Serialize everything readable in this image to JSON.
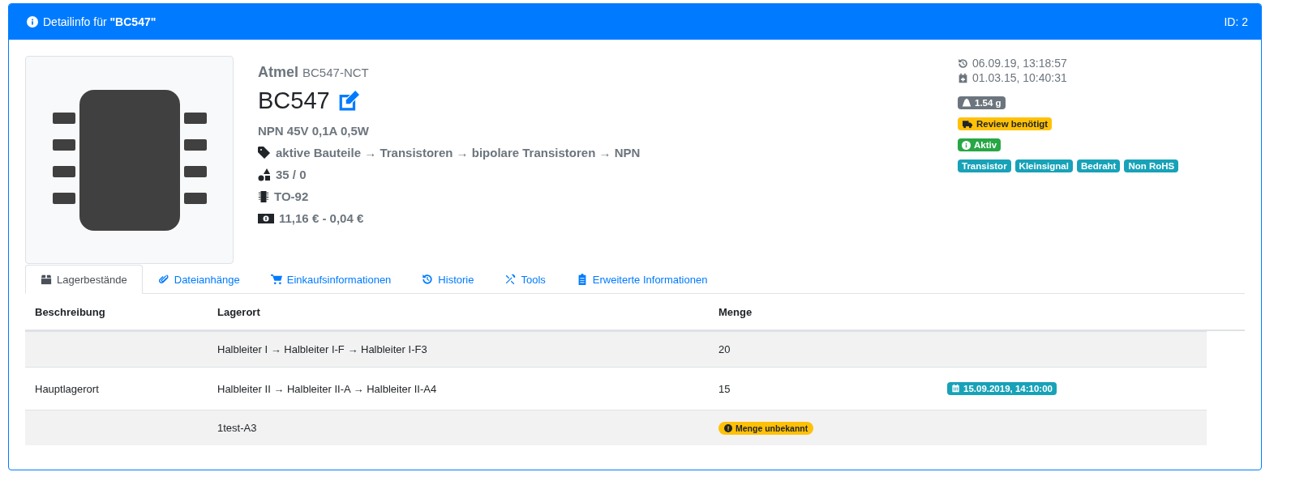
{
  "header": {
    "title": "Detailinfo für **\"BC547\"**",
    "id": "ID: 2"
  },
  "part": {
    "manufacturer": "Atmel",
    "mpn": "BC547-NCT",
    "name": "BC547",
    "description": "NPN 45V 0,1A 0,5W",
    "category": "aktive Bauteile → Transistoren → bipolare Transistoren → NPN",
    "stock": "35 / 0",
    "footprint": "TO-92",
    "price": "11,16 € - 0,04 €"
  },
  "dates": [
    {
      "kind": "modified",
      "text": "06.09.19, 13:18:57"
    },
    {
      "kind": "created",
      "text": "01.03.15, 10:40:31"
    }
  ],
  "badges": [
    {
      "kind": "weight",
      "text": "1.54 g"
    },
    {
      "kind": "review",
      "text": "Review benötigt"
    },
    {
      "kind": "status",
      "text": "Aktiv"
    }
  ],
  "tags": [
    "Transistor",
    "Kleinsignal",
    "Bedraht",
    "Non RoHS"
  ],
  "tabs": [
    {
      "label": "Lagerbestände",
      "selected": true
    },
    {
      "label": "Dateianhänge",
      "selected": false
    },
    {
      "label": "Einkaufsinformationen",
      "selected": false
    },
    {
      "label": "Historie",
      "selected": false
    },
    {
      "label": "Tools",
      "selected": false
    },
    {
      "label": "Erweiterte Informationen",
      "selected": false
    }
  ],
  "table": {
    "columns": [
      "Beschreibung",
      "Lagerort",
      "Menge"
    ],
    "rows": [
      {
        "location": "Halbleiter I → Halbleiter I-F → Halbleiter I-F3",
        "amount": "20"
      },
      {
        "description": "Hauptlagerort",
        "location": "Halbleiter II → Halbleiter II-A → Halbleiter II-A4",
        "amount": "15",
        "column_4": "15.09.2019, 14:10:00"
      },
      {
        "location": "1test-A3",
        "amount_badge": "Menge unbekannt"
      }
    ]
  }
}
